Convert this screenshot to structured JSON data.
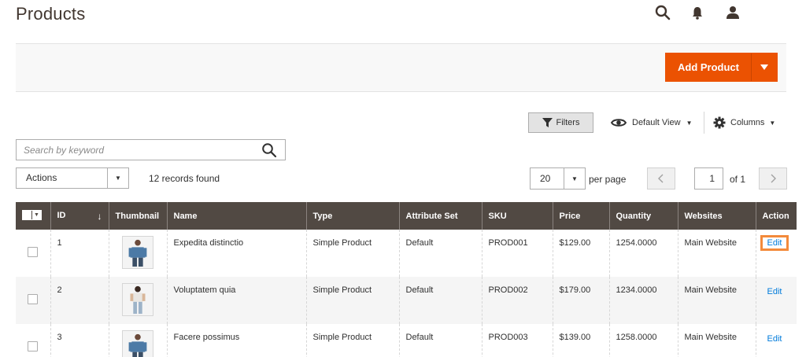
{
  "page": {
    "title": "Products"
  },
  "header": {
    "icons": [
      "search-icon",
      "bell-icon",
      "user-icon"
    ]
  },
  "toolbar": {
    "add_product_label": "Add Product"
  },
  "controls": {
    "filters_label": "Filters",
    "view_label": "Default View",
    "columns_label": "Columns",
    "search_placeholder": "Search by keyword",
    "actions_label": "Actions",
    "records_found": "12 records found",
    "per_page_value": "20",
    "per_page_label": "per page",
    "current_page": "1",
    "of_pages": "of 1"
  },
  "grid": {
    "columns": [
      "ID",
      "Thumbnail",
      "Name",
      "Type",
      "Attribute Set",
      "SKU",
      "Price",
      "Quantity",
      "Websites",
      "Action"
    ],
    "sort_indicator": "↓",
    "rows": [
      {
        "id": "1",
        "name": "Expedita distinctio",
        "type": "Simple Product",
        "attribute_set": "Default",
        "sku": "PROD001",
        "price": "$129.00",
        "quantity": "1254.0000",
        "websites": "Main Website",
        "action": "Edit"
      },
      {
        "id": "2",
        "name": "Voluptatem quia",
        "type": "Simple Product",
        "attribute_set": "Default",
        "sku": "PROD002",
        "price": "$179.00",
        "quantity": "1234.0000",
        "websites": "Main Website",
        "action": "Edit"
      },
      {
        "id": "3",
        "name": "Facere possimus",
        "type": "Simple Product",
        "attribute_set": "Default",
        "sku": "PROD003",
        "price": "$139.00",
        "quantity": "1258.0000",
        "websites": "Main Website",
        "action": "Edit"
      }
    ]
  },
  "colors": {
    "accent": "#eb5202",
    "header_bg": "#514943",
    "link": "#007bdb",
    "highlight": "#f38a3b"
  }
}
